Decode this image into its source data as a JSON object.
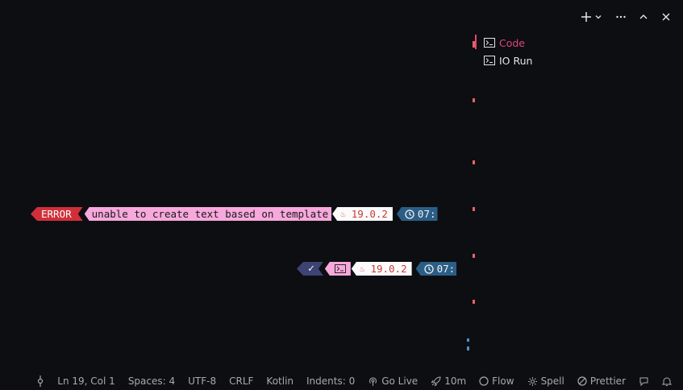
{
  "toolbar": {
    "add_icon": "plus-icon",
    "dropdown_icon": "chevron-down-icon",
    "more_icon": "ellipsis-icon",
    "maximize_icon": "chevron-up-icon",
    "close_icon": "close-icon"
  },
  "terminal_tabs": [
    {
      "label": "Code",
      "icon": "terminal-icon",
      "active": true
    },
    {
      "label": "IO Run",
      "icon": "terminal-icon",
      "active": false
    }
  ],
  "prompt_error": {
    "status": "ERROR",
    "message": "unable to create text based on template",
    "java_version": "19.0.2",
    "time": "07:"
  },
  "prompt_ok": {
    "status_icon": "check-icon",
    "terminal_icon": "terminal-icon",
    "java_version": "19.0.2",
    "time": "07:"
  },
  "statusbar": {
    "line_col": "Ln 19, Col 1",
    "spaces": "Spaces: 4",
    "encoding": "UTF-8",
    "eol": "CRLF",
    "language": "Kotlin",
    "indents": "Indents: 0",
    "go_live": "Go Live",
    "timer": "10m",
    "flow": "Flow",
    "spell": "Spell",
    "prettier": "Prettier"
  },
  "colors": {
    "background": "#0d0e12",
    "accent": "#e0457b",
    "error": "#d02f3a",
    "pink": "#f7a8dc",
    "blue": "#2b5e86",
    "indigo": "#3d4374"
  }
}
